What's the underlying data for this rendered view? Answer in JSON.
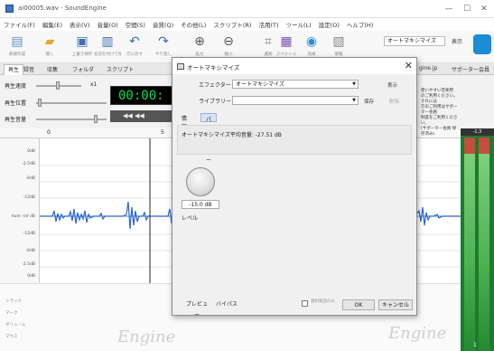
{
  "window": {
    "title": "ai00005.wav - SoundEngine",
    "minimize": "—",
    "close": "✕"
  },
  "menu": [
    "ファイル(F)",
    "編集(E)",
    "表示(V)",
    "音量(O)",
    "空間(S)",
    "音質(Q)",
    "その他(L)",
    "スクリプト(R)",
    "活用(T)",
    "ツール(L)",
    "設定(O)",
    "ヘルプ(H)"
  ],
  "ribbon": {
    "buttons": [
      {
        "icon": "new-file",
        "glyph": "▤",
        "color": "#5b8fd0",
        "label": "新規作成"
      },
      {
        "icon": "open-folder",
        "glyph": "▰",
        "color": "#e6a72b",
        "label": "開く"
      },
      {
        "icon": "save",
        "glyph": "▣",
        "color": "#3d6fb3",
        "label": "上書き保存"
      },
      {
        "icon": "save-as",
        "glyph": "▥",
        "color": "#3d6fb3",
        "label": "名前を付けて保存"
      },
      {
        "icon": "undo",
        "glyph": "↶",
        "color": "#2f6fc4",
        "label": "元に戻す"
      },
      {
        "icon": "redo",
        "glyph": "↷",
        "color": "#2f6fc4",
        "label": "やり直し"
      },
      {
        "icon": "zoom-in",
        "glyph": "⊕",
        "color": "#555555",
        "label": "拡大"
      },
      {
        "icon": "zoom-out",
        "glyph": "⊖",
        "color": "#555555",
        "label": "縮小"
      },
      {
        "icon": "select",
        "glyph": "⌗",
        "color": "#777777",
        "label": "選択"
      },
      {
        "icon": "spectrum",
        "glyph": "▦",
        "color": "#7a4fb5",
        "label": "スペクトル"
      },
      {
        "icon": "effect",
        "glyph": "◉",
        "color": "#2c8fd0",
        "label": "効果"
      },
      {
        "icon": "document",
        "glyph": "▧",
        "color": "#888888",
        "label": "情報"
      }
    ],
    "preset": "オートマキシマイズ",
    "preset_label": "表示"
  },
  "tabs": [
    "再生",
    "録音",
    "収集",
    "フォルダ",
    "スクリプト"
  ],
  "tabs_right": [
    "gine.jp",
    "サポーター会員"
  ],
  "controls": {
    "speed_label": "再生速度",
    "speed_value": "x1",
    "position_label": "再生位置",
    "volume_label": "再生音量",
    "time": "00:00:",
    "transport": "◀◀  ◀◀"
  },
  "ruler": {
    "start": "0",
    "mark": "5"
  },
  "db_labels": [
    "0dB",
    "-2.5dB",
    "-6dB",
    "-12dB",
    "hum -inf dB",
    "-12dB",
    "-6dB",
    "-2.5dB",
    "0dB"
  ],
  "meter_top": "-1.3",
  "meter_bottom": "1",
  "bottom_labels": [
    "トラック",
    "マーク",
    "ボリューム",
    "マウス"
  ],
  "watermark": "Engine",
  "dialog": {
    "title": "オートマキシマイズ",
    "close": "✕",
    "effector_label": "エフェクター",
    "effector_value": "オートマキシマイズ",
    "effector_link": "表示",
    "library_label": "ライブラリー",
    "library_value": "",
    "save_link": "保存",
    "delete_link": "削除",
    "tabs": [
      "情報",
      "パラメーター"
    ],
    "info_text": "オートマキシマイズ平均音量: -27.51 dB",
    "dial_value": "-15.0 dB",
    "dial_label": "レベル",
    "preview_button": "プレビュー",
    "bypass_button": "バイパス",
    "checkbox_label": "選択範囲のみ",
    "ok_button": "OK",
    "cancel_button": "キャンセル"
  },
  "side_note": [
    "使いやすい音楽用",
    "のご利用ください。それには",
    "方のご利用はサポーター会員",
    "制度をご利用ください。",
    "(サポーター会員 保存済み)"
  ]
}
